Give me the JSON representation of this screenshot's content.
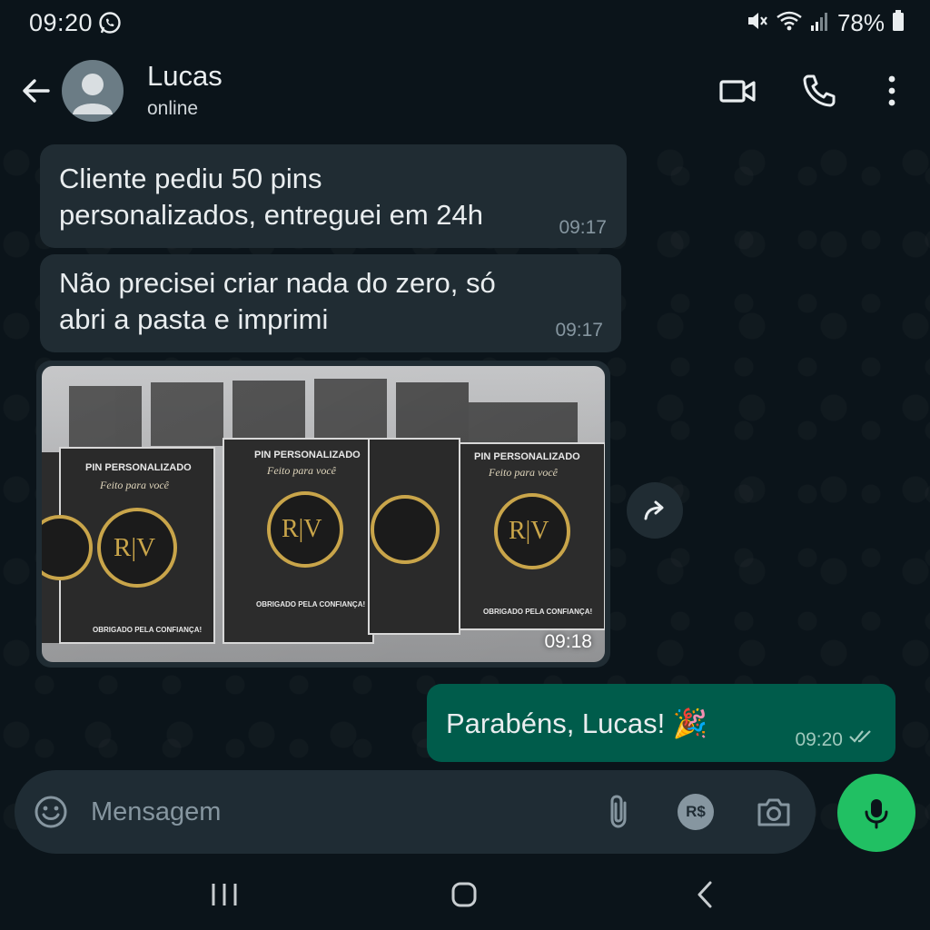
{
  "status_bar": {
    "time": "09:20",
    "battery": "78%"
  },
  "header": {
    "contact_name": "Lucas",
    "contact_status": "online"
  },
  "messages": [
    {
      "direction": "incoming",
      "text_line1": "Cliente pediu 50 pins",
      "text_line2": "personalizados, entreguei em 24h",
      "time": "09:17"
    },
    {
      "direction": "incoming",
      "text_line1": "Não precisei criar nada do zero, só",
      "text_line2": "abri a pasta e imprimi",
      "time": "09:17"
    },
    {
      "direction": "incoming",
      "type": "image",
      "time": "09:18",
      "image_text": {
        "card_title": "PIN PERSONALIZADO",
        "card_script": "Feito para você",
        "card_logo": "R|V",
        "card_footer": "OBRIGADO PELA CONFIANÇA!"
      }
    },
    {
      "direction": "outgoing",
      "text": "Parabéns, Lucas! 🎉",
      "time": "09:20",
      "status": "read"
    }
  ],
  "input": {
    "placeholder": "Mensagem",
    "payment_label": "R$"
  },
  "colors": {
    "background": "#0b141a",
    "incoming_bubble": "#202c33",
    "outgoing_bubble": "#005c4b",
    "accent": "#21c063"
  },
  "icons": [
    "whatsapp-icon",
    "mute-icon",
    "wifi-icon",
    "signal-icon",
    "battery-icon",
    "back-arrow-icon",
    "avatar-icon",
    "video-call-icon",
    "phone-call-icon",
    "more-options-icon",
    "forward-icon",
    "emoji-icon",
    "attach-icon",
    "payment-icon",
    "camera-icon",
    "mic-icon",
    "recents-icon",
    "home-icon",
    "back-nav-icon"
  ]
}
